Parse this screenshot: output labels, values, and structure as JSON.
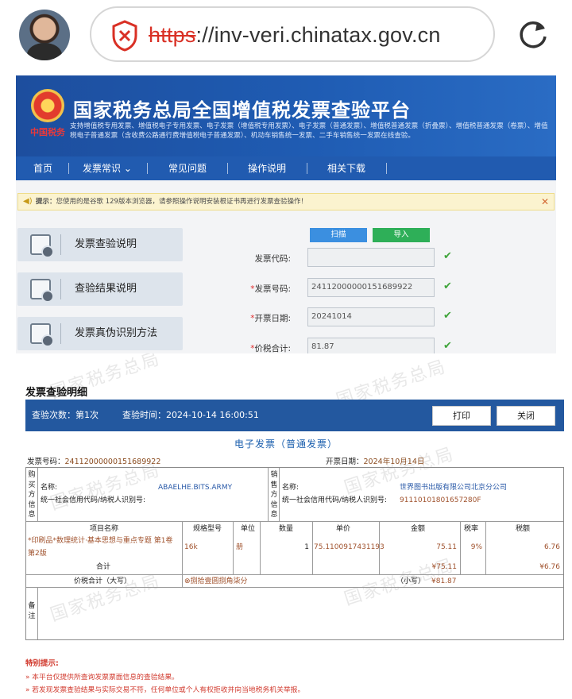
{
  "browser": {
    "url_scheme": "https",
    "url_rest": "://inv-veri.chinatax.gov.cn"
  },
  "site": {
    "emblem_caption": "中国税务",
    "title": "国家税务总局全国增值税发票查验平台",
    "subtitle": "支持增值税专用发票、增值税电子专用发票、电子发票（增值税专用发票）、电子发票（普通发票）、增值税普通发票（折叠票）、增值税普通发票（卷票）、增值税电子普通发票（含收费公路通行费增值税电子普通发票）、机动车销售统一发票、二手车销售统一发票在线查验。",
    "nav": [
      "首页",
      "发票常识",
      "常见问题",
      "操作说明",
      "相关下载"
    ],
    "notice_label": "提示：",
    "notice_text": "您使用的是谷歌 129版本浏览器，请参照操作说明安装根证书再进行发票查验操作！",
    "notice_close": "✕",
    "side_cards": [
      "发票查验说明",
      "查验结果说明",
      "发票真伪识别方法"
    ],
    "scan_label": "扫描",
    "import_label": "导入",
    "fields": [
      {
        "label": "发票代码:",
        "required": "",
        "value": ""
      },
      {
        "label": "发票号码:",
        "required": "*",
        "value": "24112000000151689922"
      },
      {
        "label": "开票日期:",
        "required": "*",
        "value": "20241014"
      },
      {
        "label": "价税合计:",
        "required": "*",
        "value": "81.87"
      }
    ]
  },
  "detail": {
    "watermark": "国家税务总局",
    "title": "发票查验明细",
    "check_count_label": "查验次数：第1次",
    "check_time_label": "查验时间：2024-10-14 16:00:51",
    "print_label": "打印",
    "close_label": "关闭",
    "invoice_type": "电子发票（普通发票）",
    "invoice_no_label": "发票号码：",
    "invoice_no": "24112000000151689922",
    "issue_date_label": "开票日期：",
    "issue_date": "2024年10月14日",
    "buyer_side": "购买方信息",
    "seller_side": "销售方信息",
    "name_label": "名称:",
    "credit_label": "统一社会信用代码/纳税人识别号:",
    "buyer_name": "ABAELHE.BITS.ARMY",
    "buyer_credit": "",
    "seller_name": "世界图书出版有限公司北京分公司",
    "seller_credit": "91110101801657280F",
    "columns": [
      "项目名称",
      "规格型号",
      "单位",
      "数量",
      "单价",
      "金额",
      "税率",
      "税额"
    ],
    "item": {
      "name_line1": "*印刷品*数理统计·基本思想与重点专题 第1卷",
      "name_line2": "第2版",
      "spec": "16k",
      "unit": "册",
      "qty": "1",
      "price": "75.1100917431193",
      "amount": "75.11",
      "rate": "9%",
      "tax": "6.76"
    },
    "subtotal_label": "合计",
    "subtotal_amount": "¥75.11",
    "subtotal_tax": "¥6.76",
    "total_label": "价税合计（大写）",
    "total_upper": "⊗捌拾壹圆捌角柒分",
    "total_lower_label": "（小写）",
    "total_lower": "¥81.87",
    "remark_label": "备注",
    "tips_title": "特别提示:",
    "tips": [
      "»  本平台仅提供所查询发票票面信息的查验结果。",
      "»  若发现发票查验结果与实际交易不符，任何单位或个人有权拒收并向当地税务机关举报。"
    ]
  }
}
